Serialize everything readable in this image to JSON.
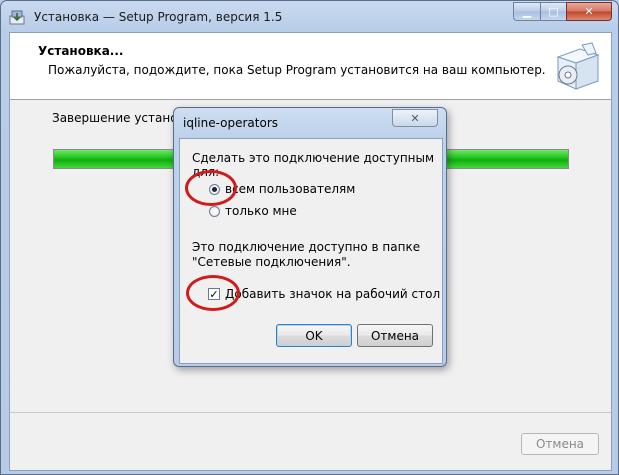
{
  "window": {
    "title": "Установка — Setup Program, версия 1.5",
    "minimize_glyph": "▁",
    "maximize_glyph": "□",
    "close_glyph": "✕"
  },
  "header": {
    "title": "Установка...",
    "subtitle": "Пожалуйста, подождите, пока Setup Program установится на ваш компьютер."
  },
  "status": {
    "text": "Завершение установки."
  },
  "progress": {
    "fraction": 1.0
  },
  "footer": {
    "cancel_label": "Отмена"
  },
  "dialog": {
    "title": "iqline-operators",
    "close_glyph": "✕",
    "prompt": "Сделать это подключение доступным для:",
    "options": [
      {
        "label": "всем пользователям",
        "selected": true
      },
      {
        "label": "только мне",
        "selected": false
      }
    ],
    "info": "Это подключение доступно в папке \"Сетевые подключения\".",
    "checkbox_label": "Добавить значок на рабочий стол",
    "checkbox_checked": true,
    "check_glyph": "✓",
    "ok_label": "OK",
    "cancel_label": "Отмена"
  },
  "colors": {
    "annotation_ring": "#d11a1a",
    "progress_green": "#1ec21a"
  },
  "icons": [
    "setup-app-icon",
    "install-box-icon"
  ]
}
